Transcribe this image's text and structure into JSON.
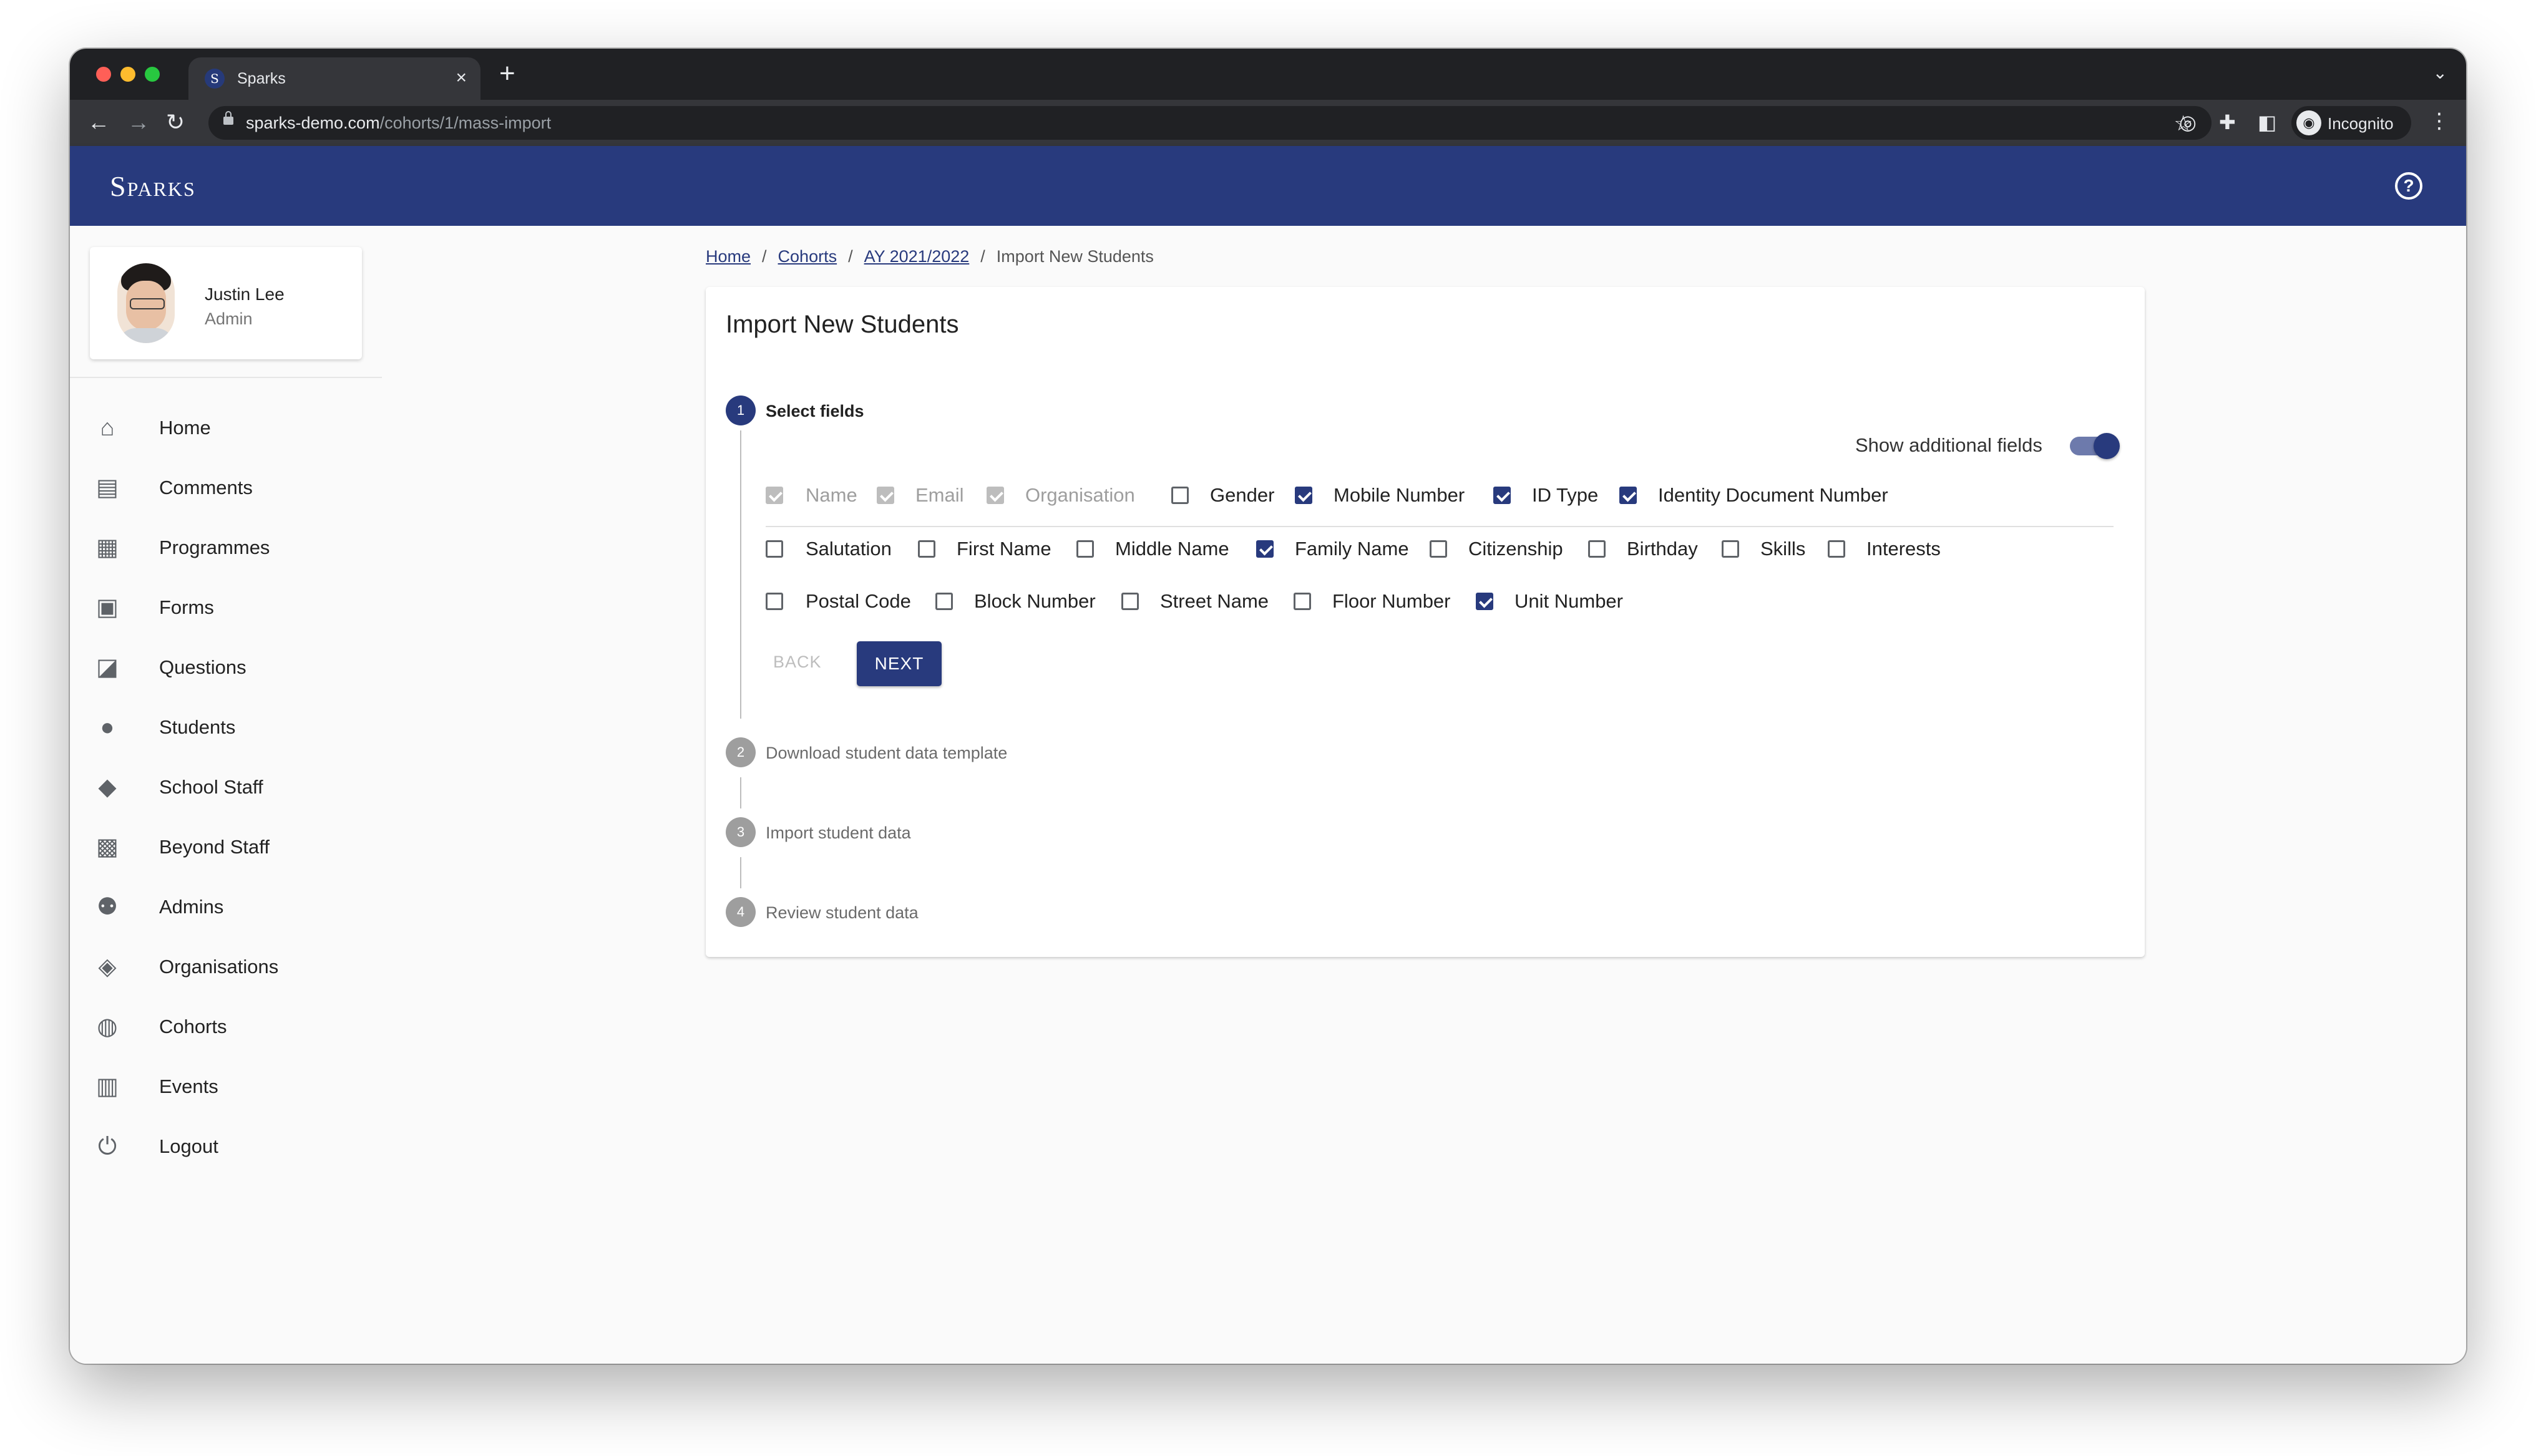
{
  "browser": {
    "tab_title": "Sparks",
    "tab_favicon_letter": "S",
    "url_host": "sparks-demo.com",
    "url_path": "/cohorts/1/mass-import",
    "profile_label": "Incognito"
  },
  "app": {
    "brand": "Sparks",
    "accent_color": "#283a7d"
  },
  "profile": {
    "name": "Justin Lee",
    "role": "Admin"
  },
  "sidebar": {
    "items": [
      {
        "label": "Home",
        "icon": "home-icon"
      },
      {
        "label": "Comments",
        "icon": "comment-icon"
      },
      {
        "label": "Programmes",
        "icon": "document-icon"
      },
      {
        "label": "Forms",
        "icon": "clipboard-icon"
      },
      {
        "label": "Questions",
        "icon": "forum-icon"
      },
      {
        "label": "Students",
        "icon": "person-icon"
      },
      {
        "label": "School Staff",
        "icon": "book-reader-icon"
      },
      {
        "label": "Beyond Staff",
        "icon": "badge-icon"
      },
      {
        "label": "Admins",
        "icon": "people-icon"
      },
      {
        "label": "Organisations",
        "icon": "school-icon"
      },
      {
        "label": "Cohorts",
        "icon": "group-circle-icon"
      },
      {
        "label": "Events",
        "icon": "calendar-icon"
      },
      {
        "label": "Logout",
        "icon": "power-icon"
      }
    ]
  },
  "breadcrumb": {
    "items": [
      "Home",
      "Cohorts",
      "AY 2021/2022"
    ],
    "current": "Import New Students",
    "separator": "/"
  },
  "card": {
    "title": "Import New Students"
  },
  "stepper": {
    "steps": [
      {
        "number": "1",
        "label": "Select fields",
        "active": true
      },
      {
        "number": "2",
        "label": "Download student data template",
        "active": false
      },
      {
        "number": "3",
        "label": "Import student data",
        "active": false
      },
      {
        "number": "4",
        "label": "Review student data",
        "active": false
      }
    ]
  },
  "toggle": {
    "label": "Show additional fields",
    "on": true
  },
  "fields": {
    "row1": [
      {
        "label": "Name",
        "checked": true,
        "disabled": true
      },
      {
        "label": "Email",
        "checked": true,
        "disabled": true
      },
      {
        "label": "Organisation",
        "checked": true,
        "disabled": true
      },
      {
        "label": "Gender",
        "checked": false,
        "disabled": false
      },
      {
        "label": "Mobile Number",
        "checked": true,
        "disabled": false
      },
      {
        "label": "ID Type",
        "checked": true,
        "disabled": false
      },
      {
        "label": "Identity Document Number",
        "checked": true,
        "disabled": false
      }
    ],
    "row2": [
      {
        "label": "Salutation",
        "checked": false,
        "disabled": false
      },
      {
        "label": "First Name",
        "checked": false,
        "disabled": false
      },
      {
        "label": "Middle Name",
        "checked": false,
        "disabled": false
      },
      {
        "label": "Family Name",
        "checked": true,
        "disabled": false
      },
      {
        "label": "Citizenship",
        "checked": false,
        "disabled": false
      },
      {
        "label": "Birthday",
        "checked": false,
        "disabled": false
      },
      {
        "label": "Skills",
        "checked": false,
        "disabled": false
      },
      {
        "label": "Interests",
        "checked": false,
        "disabled": false
      }
    ],
    "row3": [
      {
        "label": "Postal Code",
        "checked": false,
        "disabled": false
      },
      {
        "label": "Block Number",
        "checked": false,
        "disabled": false
      },
      {
        "label": "Street Name",
        "checked": false,
        "disabled": false
      },
      {
        "label": "Floor Number",
        "checked": false,
        "disabled": false
      },
      {
        "label": "Unit Number",
        "checked": true,
        "disabled": false
      }
    ]
  },
  "buttons": {
    "back": "BACK",
    "next": "NEXT"
  }
}
